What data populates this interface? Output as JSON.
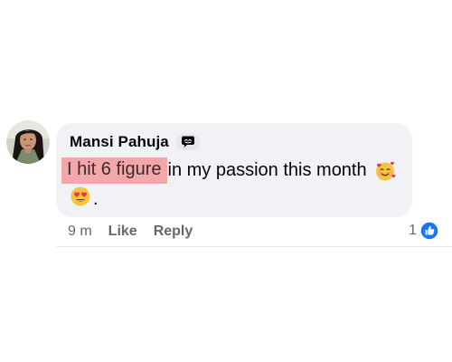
{
  "comment": {
    "author": "Mansi Pahuja",
    "text_highlighted": "I hit 6 figure",
    "text_rest": " in my passion this month",
    "text_period": "."
  },
  "actions": {
    "time": "9 m",
    "like_label": "Like",
    "reply_label": "Reply"
  },
  "reactions": {
    "count": "1",
    "type": "like"
  },
  "icons": {
    "author_badge": "top-fan-chat-icon",
    "emoji_1": "smiling-face-with-hearts-emoji",
    "emoji_2": "heart-eyes-emoji",
    "reaction": "like-thumb-icon"
  },
  "colors": {
    "bubble": "#f0f2f5",
    "highlight": "#f3a7ab",
    "like_blue": "#1877f2",
    "secondary_text": "#65676b"
  }
}
